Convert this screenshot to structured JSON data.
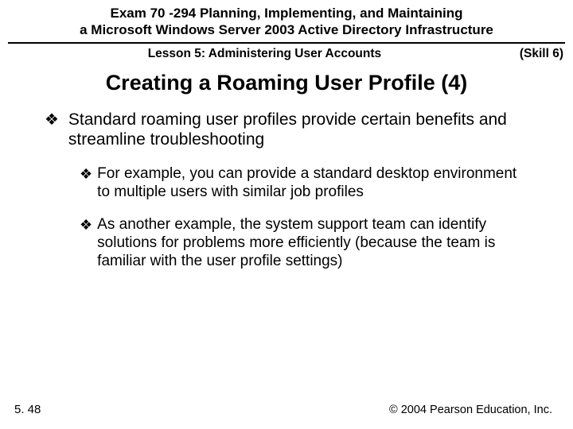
{
  "header": {
    "exam_title_line1": "Exam 70 -294 Planning, Implementing, and Maintaining",
    "exam_title_line2": "a Microsoft Windows Server 2003 Active Directory Infrastructure",
    "lesson": "Lesson 5: Administering User Accounts",
    "skill": "(Skill 6)"
  },
  "slide": {
    "title": "Creating a Roaming User Profile (4)"
  },
  "bullets": {
    "main_1": "Standard roaming user profiles provide certain benefits and streamline troubleshooting",
    "sub_1": "For example, you can provide a standard desktop environment to multiple users with similar job profiles",
    "sub_2": "As another example, the system support team can identify solutions for problems more efficiently (because the team is familiar with the user profile settings)"
  },
  "footer": {
    "page": "5. 48",
    "copyright": "© 2004 Pearson Education, Inc."
  },
  "glyphs": {
    "diamond": "❖"
  }
}
